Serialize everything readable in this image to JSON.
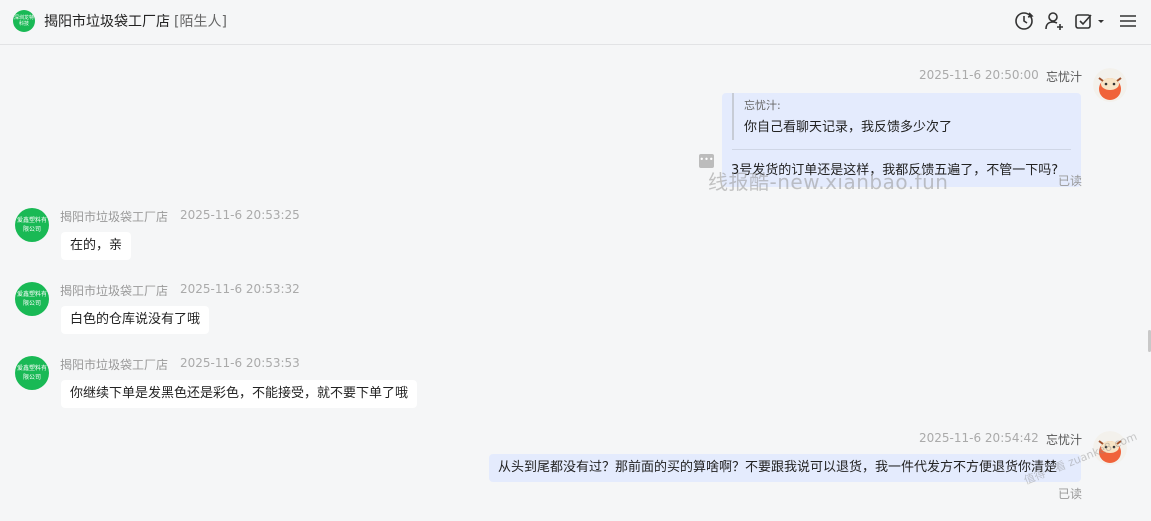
{
  "header": {
    "logo_text": "深圳龙特科技",
    "title": "揭阳市垃圾袋工厂店",
    "tag": "[陌生人]",
    "icons": [
      "refresh-icon",
      "user-add-icon",
      "checklist-dropdown-icon",
      "menu-icon"
    ]
  },
  "messages": {
    "m1": {
      "time": "2025-11-6 20:50:00",
      "sender": "忘忧汁",
      "quote_author": "忘忧汁:",
      "quote_text": "你自己看聊天记录，我反馈多少次了",
      "text": "3号发货的订单还是这样，我都反馈五遍了，不管一下吗?",
      "status": "已读"
    },
    "m2": {
      "sender": "揭阳市垃圾袋工厂店",
      "time": "2025-11-6 20:53:25",
      "text": "在的，亲",
      "avatar_text": "爱鑫塑料有限公司"
    },
    "m3": {
      "sender": "揭阳市垃圾袋工厂店",
      "time": "2025-11-6 20:53:32",
      "text": "白色的仓库说没有了哦",
      "avatar_text": "爱鑫塑料有限公司"
    },
    "m4": {
      "sender": "揭阳市垃圾袋工厂店",
      "time": "2025-11-6 20:53:53",
      "text": "你继续下单是发黑色还是彩色，不能接受，就不要下单了哦",
      "avatar_text": "爱鑫塑料有限公司"
    },
    "m5": {
      "time": "2025-11-6 20:54:42",
      "sender": "忘忧汁",
      "text": "从头到尾都没有过？那前面的买的算啥啊？不要跟我说可以退货，我一件代发方不方便退货你清楚",
      "status": "已读"
    }
  },
  "watermark": "线报酷-new.xianbao.fun",
  "watermark2": "值得一看 zuanke8.com",
  "colors": {
    "brand_green": "#19b955",
    "out_bubble": "#e4ebfd",
    "in_bubble": "#ffffff",
    "background": "#f5f6f7"
  }
}
